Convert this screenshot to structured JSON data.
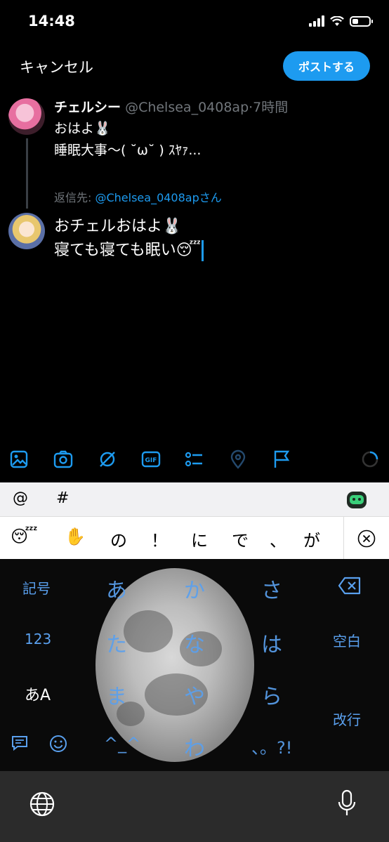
{
  "status_bar": {
    "time": "14:48"
  },
  "header": {
    "cancel_label": "キャンセル",
    "post_label": "ポストする"
  },
  "original_tweet": {
    "display_name": "チェルシー",
    "handle_time": "@Chelsea_0408ap·7時間",
    "text": "おはよ🐰\n睡眠大事〜( ˘ω˘ ) ｽﾔｧ..."
  },
  "reply": {
    "reply_to_prefix": "返信先: ",
    "reply_to_mention": "@Chelsea_0408ap",
    "reply_to_suffix": "さん",
    "compose_text": "おチェルおはよ🐰\n寝ても寝ても眠い😴"
  },
  "toolbar": {
    "icons": [
      "image-icon",
      "camera-icon",
      "grok-icon",
      "gif-icon",
      "poll-icon",
      "location-icon",
      "flag-icon",
      "progress-ring-icon"
    ],
    "gif_label": "GIF",
    "accent": "#1d9bf0"
  },
  "keyboard": {
    "tags": [
      "@",
      "#"
    ],
    "candidates": [
      "😴",
      "✋",
      "の",
      "！",
      "に",
      "で",
      "、",
      "が"
    ],
    "left_keys": [
      "記号",
      "123",
      "あA"
    ],
    "right_keys": [
      "空白",
      "改行"
    ],
    "kana_rows": [
      [
        "あ",
        "か",
        "さ"
      ],
      [
        "た",
        "な",
        "は"
      ],
      [
        "ま",
        "や",
        "ら"
      ],
      [
        "^_^",
        "わ",
        "、。?!"
      ]
    ],
    "kana_color": "#5aa0ee"
  }
}
